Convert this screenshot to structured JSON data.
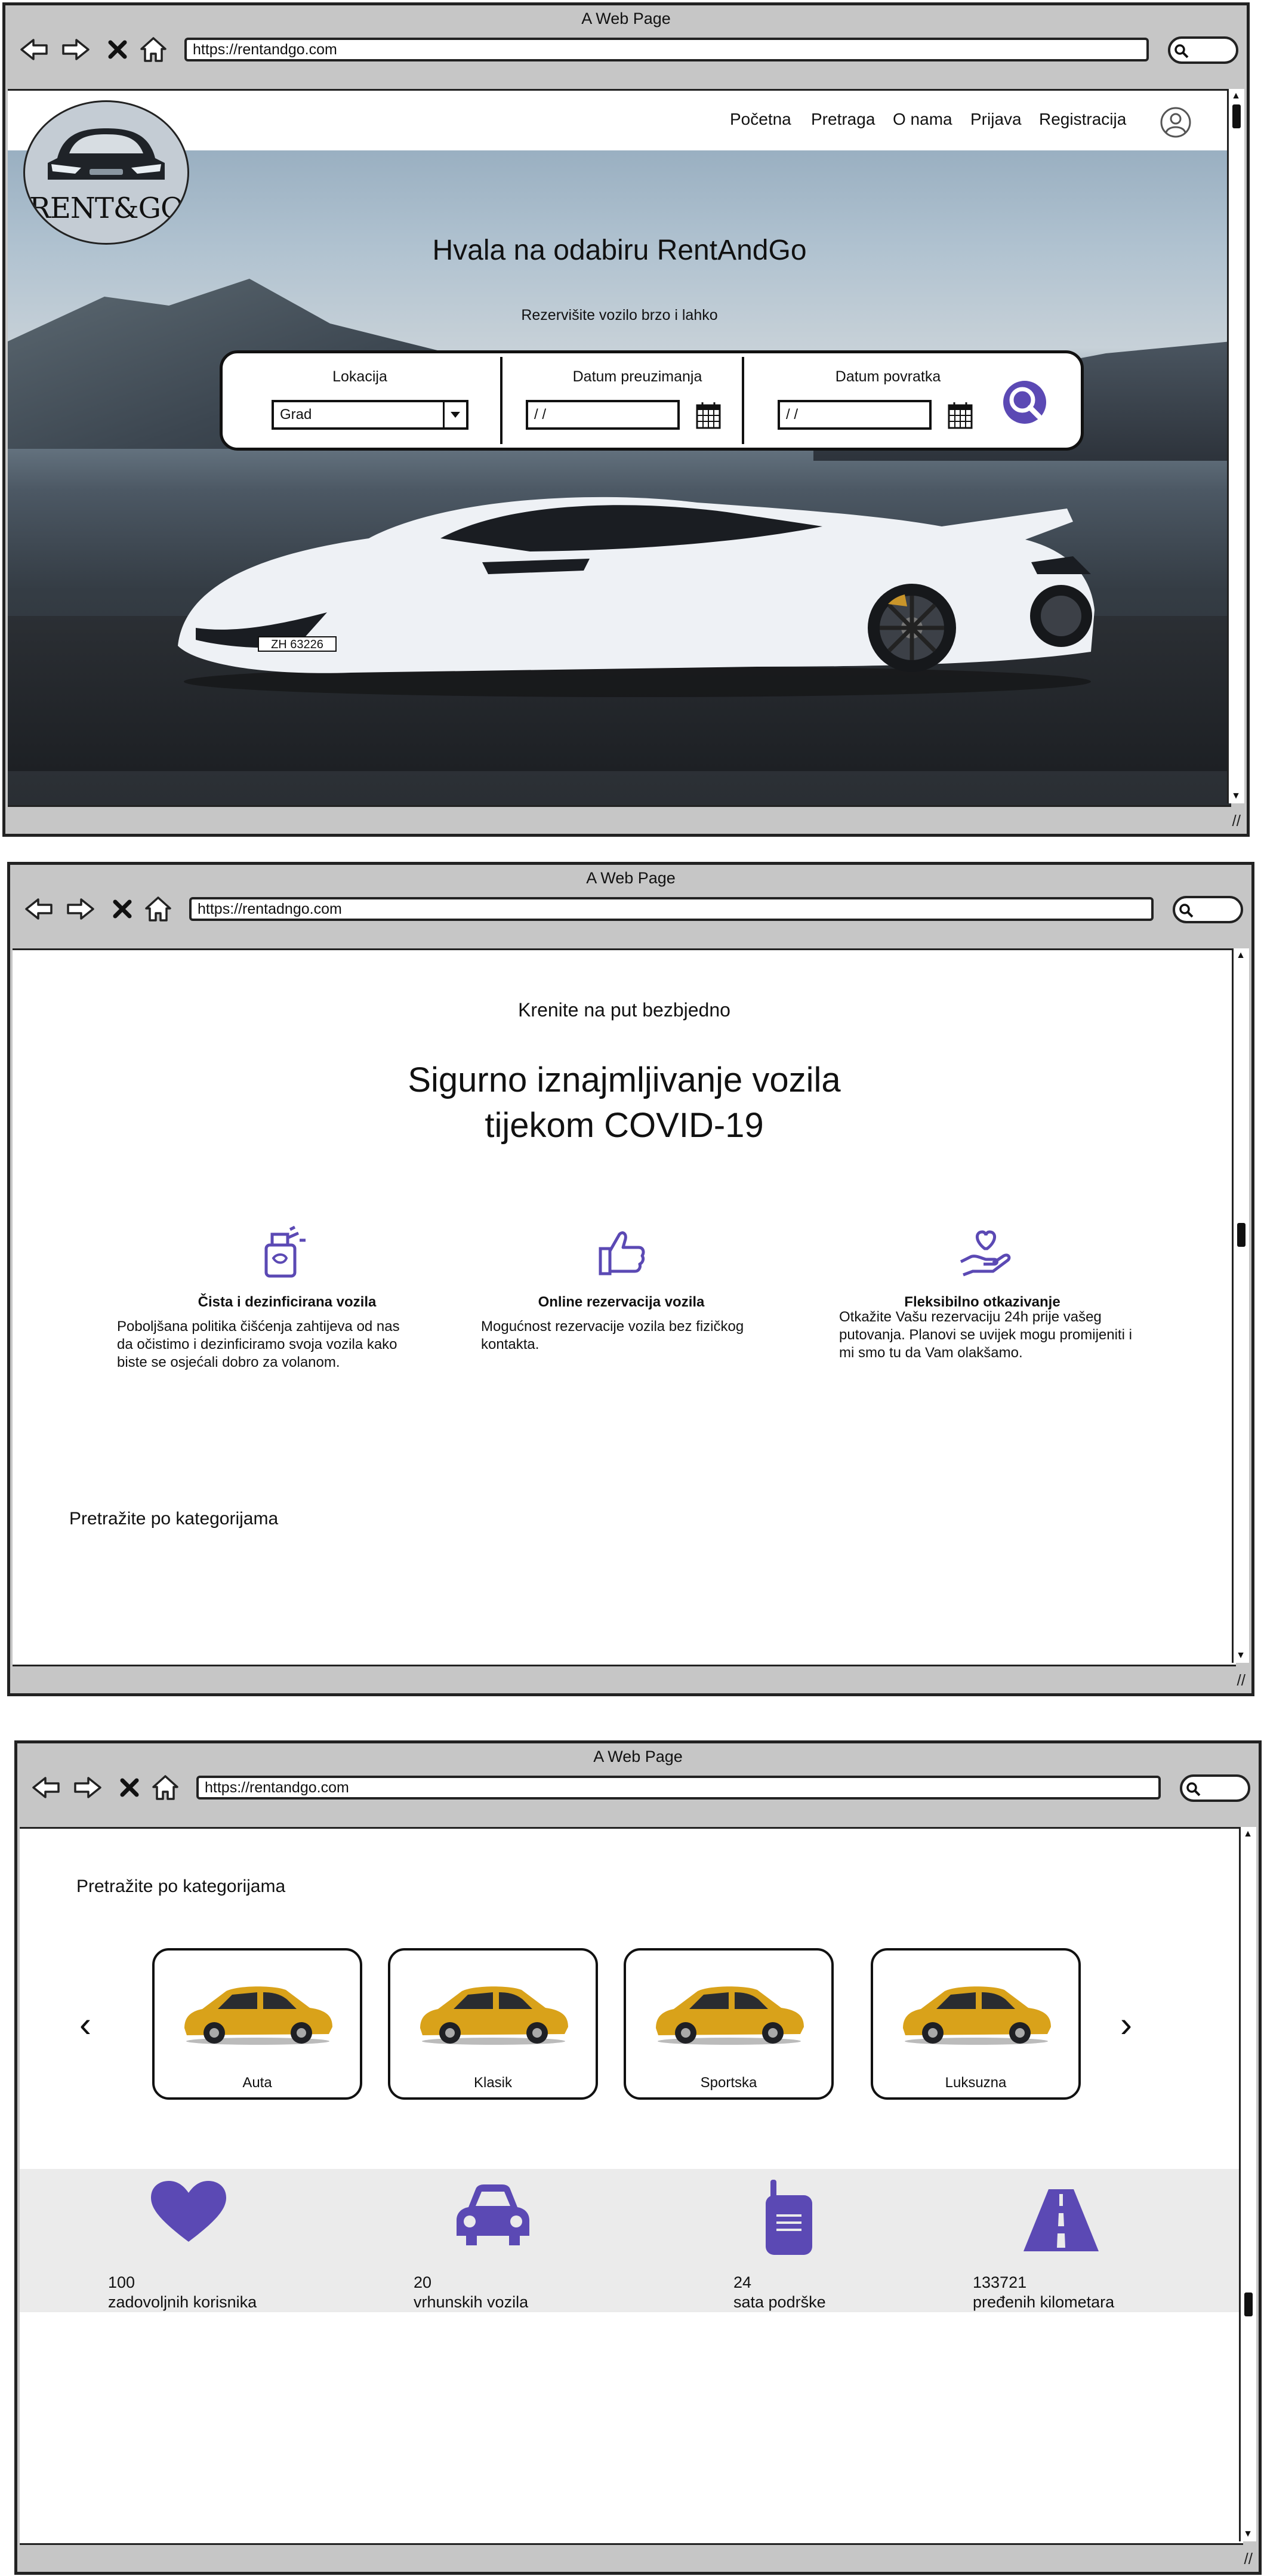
{
  "windows": [
    {
      "title": "A Web Page",
      "url": "https://rentandgo.com"
    },
    {
      "title": "A Web Page",
      "url": "https://rentadngo.com"
    },
    {
      "title": "A Web Page",
      "url": "https://rentandgo.com"
    }
  ],
  "brand": {
    "logo_text": "RENT&GO"
  },
  "nav": {
    "items": [
      "Početna",
      "Pretraga",
      "O nama",
      "Prijava",
      "Registracija"
    ]
  },
  "hero": {
    "title": "Hvala na odabiru RentAndGo",
    "subtitle": "Rezervišite vozilo brzo i lahko",
    "plate": "ZH 63226"
  },
  "search": {
    "location_label": "Lokacija",
    "location_value": "Grad",
    "pickup_label": "Datum preuzimanja",
    "pickup_value": "/  /",
    "return_label": "Datum povratka",
    "return_value": "/  /"
  },
  "safety": {
    "kicker": "Krenite na put bezbjedno",
    "title_line1": "Sigurno iznajmljivanje vozila",
    "title_line2": "tijekom COVID-19",
    "features": [
      {
        "icon": "cleaning-spray-icon",
        "title": "Čista i dezinficirana vozila",
        "lines": [
          "Poboljšana politika čišćenja zahtijeva od nas",
          "da očistimo i dezinficiramo svoja vozila kako",
          "biste se osjećali dobro za volanom."
        ]
      },
      {
        "icon": "thumbs-up-icon",
        "title": "Online rezervacija vozila",
        "lines": [
          "Mogućnost rezervacije vozila bez fizičkog",
          "kontakta."
        ]
      },
      {
        "icon": "heart-hand-icon",
        "title": "Fleksibilno otkazivanje",
        "lines": [
          "Otkažite Vašu rezervaciju 24h prije vašeg",
          "putovanja. Planovi se uvijek mogu promijeniti i",
          "mi smo tu da Vam olakšamo."
        ]
      }
    ]
  },
  "categories": {
    "heading": "Pretražite po kategorijama",
    "items": [
      "Auta",
      "Klasik",
      "Sportska",
      "Luksuzna"
    ]
  },
  "stats": [
    {
      "icon": "heart-icon",
      "number": "100",
      "label": "zadovoljnih korisnika"
    },
    {
      "icon": "car-icon",
      "number": "20",
      "label": "vrhunskih vozila"
    },
    {
      "icon": "walkie-talkie-icon",
      "number": "24",
      "label": "sata podrške"
    },
    {
      "icon": "road-icon",
      "number": "133721",
      "label": "pređenih kilometara"
    }
  ],
  "colors": {
    "accent": "#5b49b4",
    "chrome": "#c6c6c6",
    "stats_bg": "#ebebeb",
    "car_yellow": "#d9a21a"
  }
}
